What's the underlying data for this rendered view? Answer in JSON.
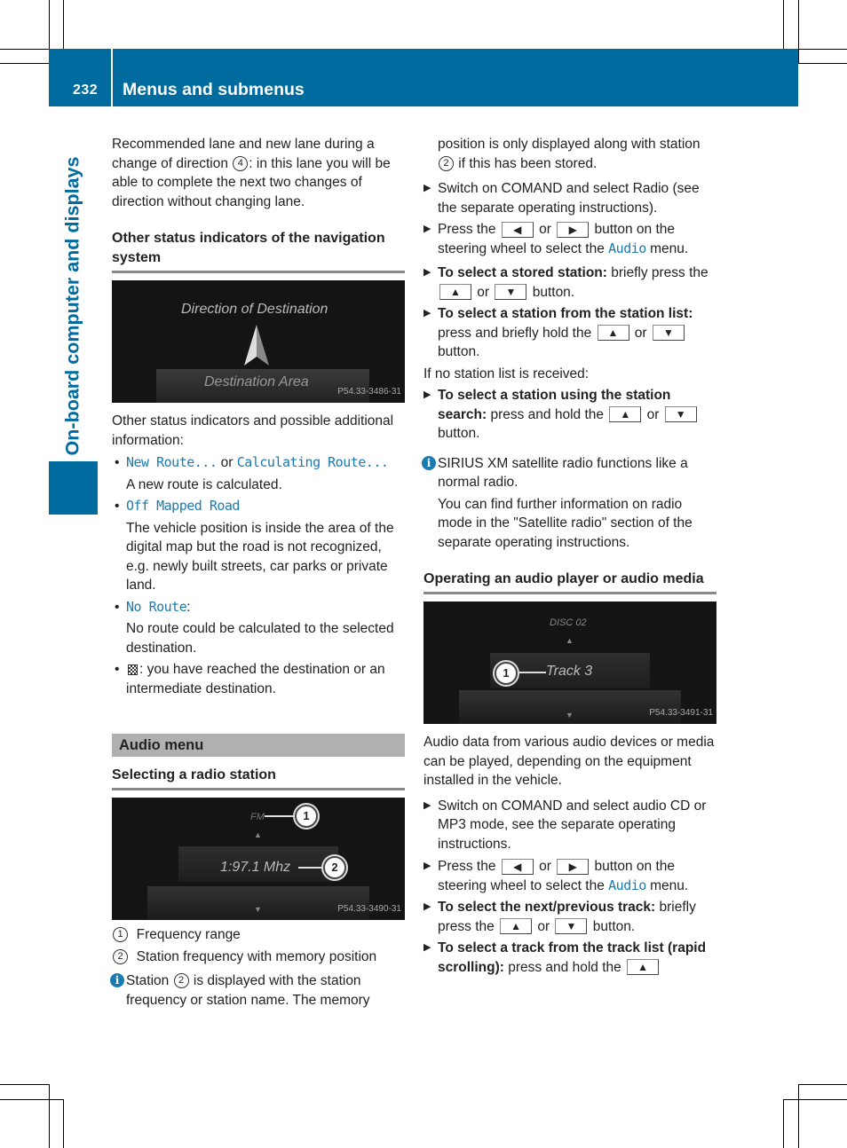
{
  "header": {
    "page_number": "232",
    "title": "Menus and submenus"
  },
  "side_label": "On-board computer and displays",
  "col1": {
    "intro": [
      "Recommended lane and new lane during a change of direction ",
      "4",
      ": in this lane you will be able to complete the next two changes of direction without changing lane."
    ],
    "heading_status": "Other status indicators of the navigation system",
    "figure1": {
      "title": "Direction of Destination",
      "subtitle": "Destination Area",
      "code": "P54.33-3486-31"
    },
    "status_intro": "Other status indicators and possible additional information:",
    "bullets": [
      {
        "code_a": "New Route...",
        "joiner": " or ",
        "code_b": "Calculating Route...",
        "text": "A new route is calculated."
      },
      {
        "code_a": "Off Mapped Road",
        "text": "The vehicle position is inside the area of the digital map but the road is not recognized, e.g. newly built streets, car parks or private land."
      },
      {
        "code_a": "No Route",
        "suffix": ":",
        "text": "No route could be calculated to the selected destination."
      },
      {
        "icon": "checkered-flag-icon",
        "text_inline": ": you have reached the destination or an intermediate destination."
      }
    ],
    "section_title": "Audio menu",
    "heading_radio": "Selecting a radio station",
    "figure2": {
      "band_label": "FM",
      "freq_label": "1:97.1 Mhz",
      "callout1": "1",
      "callout2": "2",
      "code": "P54.33-3490-31"
    },
    "legend": [
      {
        "num": "1",
        "text": "Frequency range"
      },
      {
        "num": "2",
        "text": "Station frequency with memory position"
      }
    ],
    "info1": {
      "pre": "Station ",
      "num": "2",
      "post": " is displayed with the station frequency or station name. The memory"
    }
  },
  "col2": {
    "info1_cont": {
      "pre": "position is only displayed along with station ",
      "num": "2",
      "post": " if this has been stored."
    },
    "steps_radio": [
      {
        "text": "Switch on COMAND and select Radio (see the separate operating instructions)."
      },
      {
        "pre": "Press the ",
        "key1": "◀",
        "mid": " or ",
        "key2": "▶",
        "post": " button on the steering wheel to select the ",
        "code": "Audio",
        "end": " menu."
      },
      {
        "bold": "To select a stored station:",
        "pre": " briefly press the ",
        "key1": "▲",
        "mid": " or ",
        "key2": "▼",
        "post": " button."
      },
      {
        "bold": "To select a station from the station list:",
        "pre": " press and briefly hold the ",
        "key1": "▲",
        "mid": " or ",
        "key2": "▼",
        "post": " button."
      }
    ],
    "no_list": "If no station list is received:",
    "step_search": {
      "bold": "To select a station using the station search:",
      "pre": " press and hold the ",
      "key1": "▲",
      "mid": " or ",
      "key2": "▼",
      "post": " button."
    },
    "info_sirius": {
      "line1": "SIRIUS XM satellite radio functions like a normal radio.",
      "line2": "You can find further information on radio mode in the \"Satellite radio\" section of the separate operating instructions."
    },
    "heading_audio": "Operating an audio player or audio media",
    "figure3": {
      "disc_label": "DISC 02",
      "track_label": "Track 3",
      "callout1": "1",
      "code": "P54.33-3491-31"
    },
    "audio_intro": "Audio data from various audio devices or media can be played, depending on the equipment installed in the vehicle.",
    "steps_audio": [
      {
        "text": "Switch on COMAND and select audio CD or MP3 mode, see the separate operating instructions."
      },
      {
        "pre": "Press the ",
        "key1": "◀",
        "mid": " or ",
        "key2": "▶",
        "post": " button on the steering wheel to select the ",
        "code": "Audio",
        "end": " menu."
      },
      {
        "bold": "To select the next/previous track:",
        "pre": " briefly press the ",
        "key1": "▲",
        "mid": " or ",
        "key2": "▼",
        "post": " button."
      },
      {
        "bold": "To select a track from the track list (rapid scrolling):",
        "pre": " press and hold the ",
        "key1": "▲"
      }
    ]
  },
  "colors": {
    "brand_blue": "#006b9f",
    "code_blue": "#1a7bb0",
    "section_gray": "#b0b0b0"
  }
}
